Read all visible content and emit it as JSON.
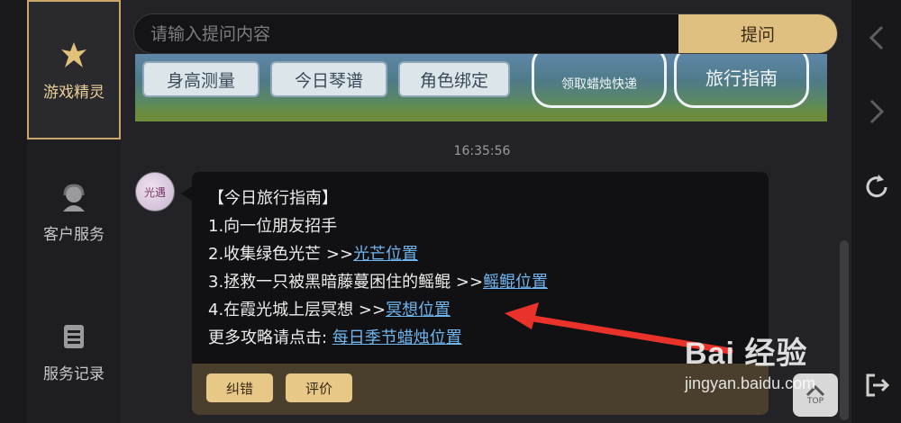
{
  "sidebar": {
    "items": [
      {
        "label": "游戏精灵",
        "icon": "fairy-icon",
        "active": true
      },
      {
        "label": "客户服务",
        "icon": "headset-icon"
      },
      {
        "label": "服务记录",
        "icon": "record-list-icon"
      }
    ]
  },
  "search": {
    "placeholder": "请输入提问内容",
    "value": "",
    "button_label": "提问"
  },
  "banner": {
    "buttons": [
      "身高测量",
      "今日琴谱",
      "角色绑定"
    ],
    "cards": [
      "领取蜡烛快递",
      "旅行指南"
    ]
  },
  "chat": {
    "timestamp": "16:35:56",
    "avatar_text": "光遇",
    "message": {
      "title": "【今日旅行指南】",
      "line1": "1.向一位朋友招手",
      "line2_text": "2.收集绿色光芒 >>",
      "line2_link": "光芒位置",
      "line3_text": "3.拯救一只被黑暗藤蔓困住的鳐鲲 >>",
      "line3_link": "鳐鲲位置",
      "line4_text": "4.在霞光城上层冥想 >>",
      "line4_link": "冥想位置",
      "line5_text": "更多攻略请点击: ",
      "line5_link": "每日季节蜡烛位置"
    },
    "footer_buttons": [
      "纠错",
      "评价"
    ]
  },
  "top_button_label": "TOP",
  "watermark": {
    "main": "Bai 经验",
    "sub": "jingyan.baidu.com"
  },
  "colors": {
    "accent": "#e0c080",
    "link": "#6fb5ef",
    "arrow": "#e8322a"
  }
}
